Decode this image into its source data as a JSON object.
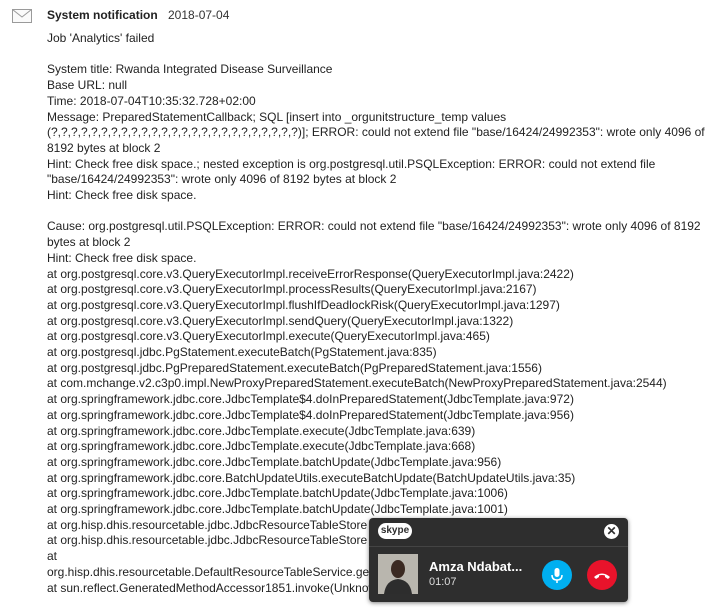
{
  "notification": {
    "title": "System notification",
    "date": "2018-07-04",
    "subject": "Job 'Analytics' failed",
    "lines_a": [
      "System title: Rwanda Integrated Disease Surveillance",
      "Base URL: null",
      "Time: 2018-07-04T10:35:32.728+02:00"
    ],
    "message": "Message: PreparedStatementCallback; SQL [insert into _orgunitstructure_temp values (?,?,?,?,?,?,?,?,?,?,?,?,?,?,?,?,?,?,?,?,?,?,?,?,?)]; ERROR: could not extend file \"base/16424/24992353\": wrote only 4096 of 8192 bytes at block 2",
    "hint1": "Hint: Check free disk space.; nested exception is org.postgresql.util.PSQLException: ERROR: could not extend file \"base/16424/24992353\": wrote only 4096 of 8192 bytes at block 2",
    "hint2": "Hint: Check free disk space.",
    "cause": "Cause: org.postgresql.util.PSQLException: ERROR: could not extend file \"base/16424/24992353\": wrote only 4096 of 8192 bytes at block 2",
    "hint3": "Hint: Check free disk space.",
    "stack": [
      "at org.postgresql.core.v3.QueryExecutorImpl.receiveErrorResponse(QueryExecutorImpl.java:2422)",
      "at org.postgresql.core.v3.QueryExecutorImpl.processResults(QueryExecutorImpl.java:2167)",
      "at org.postgresql.core.v3.QueryExecutorImpl.flushIfDeadlockRisk(QueryExecutorImpl.java:1297)",
      "at org.postgresql.core.v3.QueryExecutorImpl.sendQuery(QueryExecutorImpl.java:1322)",
      "at org.postgresql.core.v3.QueryExecutorImpl.execute(QueryExecutorImpl.java:465)",
      "at org.postgresql.jdbc.PgStatement.executeBatch(PgStatement.java:835)",
      "at org.postgresql.jdbc.PgPreparedStatement.executeBatch(PgPreparedStatement.java:1556)",
      "at com.mchange.v2.c3p0.impl.NewProxyPreparedStatement.executeBatch(NewProxyPreparedStatement.java:2544)",
      "at org.springframework.jdbc.core.JdbcTemplate$4.doInPreparedStatement(JdbcTemplate.java:972)",
      "at org.springframework.jdbc.core.JdbcTemplate$4.doInPreparedStatement(JdbcTemplate.java:956)",
      "at org.springframework.jdbc.core.JdbcTemplate.execute(JdbcTemplate.java:639)",
      "at org.springframework.jdbc.core.JdbcTemplate.execute(JdbcTemplate.java:668)",
      "at org.springframework.jdbc.core.JdbcTemplate.batchUpdate(JdbcTemplate.java:956)",
      "at org.springframework.jdbc.core.BatchUpdateUtils.executeBatchUpdate(BatchUpdateUtils.java:35)",
      "at org.springframework.jdbc.core.JdbcTemplate.batchUpdate(JdbcTemplate.java:1006)",
      "at org.springframework.jdbc.core.JdbcTemplate.batchUpdate(JdbcTemplate.java:1001)",
      "at org.hisp.dhis.resourcetable.jdbc.JdbcResourceTableStore",
      "at org.hisp.dhis.resourcetable.jdbc.JdbcResourceTableStore                                                re.java:125)",
      "at",
      "org.hisp.dhis.resourcetable.DefaultResourceTableService.ge                                                ceTableService",
      "at sun.reflect.GeneratedMethodAccessor1851.invoke(Unknow"
    ]
  },
  "skype": {
    "logo": "skype",
    "close": "✕",
    "caller": "Amza Ndabat...",
    "duration": "01:07",
    "mic_color": "#00aff0",
    "end_color": "#e8132b"
  }
}
